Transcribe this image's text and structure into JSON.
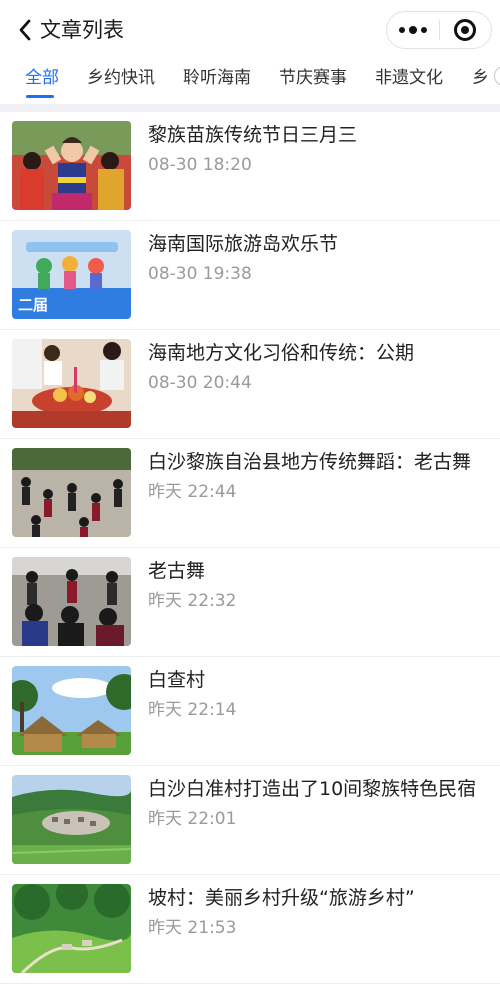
{
  "navbar": {
    "title": "文章列表",
    "back_icon": "chevron-left-icon",
    "more_icon": "more-dots-icon",
    "close_icon": "target-circle-icon"
  },
  "tabs": [
    {
      "label": "全部",
      "active": true
    },
    {
      "label": "乡约快讯",
      "active": false
    },
    {
      "label": "聆听海南",
      "active": false
    },
    {
      "label": "节庆赛事",
      "active": false
    },
    {
      "label": "非遗文化",
      "active": false
    },
    {
      "label": "乡",
      "active": false
    }
  ],
  "colors": {
    "accent": "#1e6ff2",
    "time_text": "#9a9a9a",
    "divider_band": "#f1f1f5"
  },
  "articles": [
    {
      "title": "黎族苗族传统节日三月三",
      "time": "08-30 18:20"
    },
    {
      "title": "海南国际旅游岛欢乐节",
      "time": "08-30 19:38",
      "image_text": "二届"
    },
    {
      "title": "海南地方文化习俗和传统：公期",
      "time": "08-30 20:44"
    },
    {
      "title": "白沙黎族自治县地方传统舞蹈：老古舞",
      "time": "昨天 22:44"
    },
    {
      "title": "老古舞",
      "time": "昨天 22:32"
    },
    {
      "title": "白查村",
      "time": "昨天 22:14"
    },
    {
      "title": "白沙白准村打造出了10间黎族特色民宿",
      "time": "昨天 22:01"
    },
    {
      "title": "坡村：美丽乡村升级“旅游乡村”",
      "time": "昨天 21:53"
    }
  ]
}
